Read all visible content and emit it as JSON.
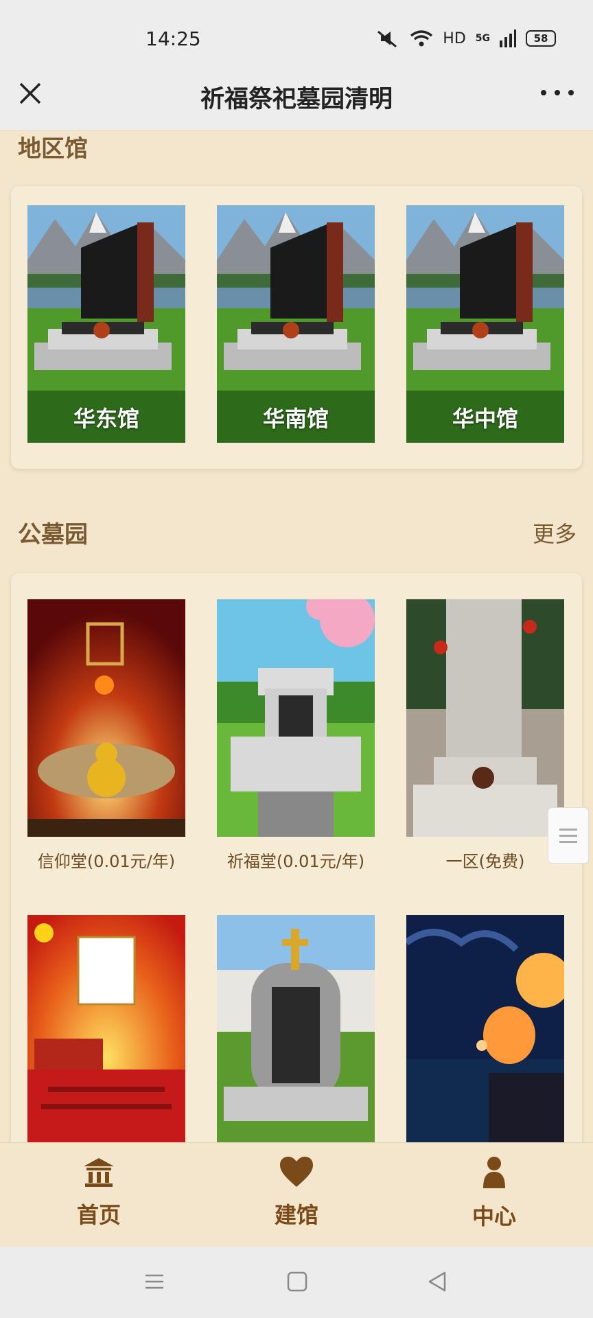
{
  "status": {
    "time": "14:25",
    "network": "HD",
    "signal": "5G",
    "battery": "58"
  },
  "header": {
    "title": "祈福祭祀墓园清明",
    "close_icon": "close-icon",
    "more_icon": "more-dots-icon"
  },
  "regions": {
    "title": "地区馆",
    "items": [
      {
        "label": "华东馆"
      },
      {
        "label": "华南馆"
      },
      {
        "label": "华中馆"
      }
    ]
  },
  "cemetery": {
    "title": "公墓园",
    "more": "更多",
    "items": [
      {
        "label": "信仰堂(0.01元/年)"
      },
      {
        "label": "祈福堂(0.01元/年)"
      },
      {
        "label": "一区(免费)"
      },
      {
        "label": ""
      },
      {
        "label": ""
      },
      {
        "label": ""
      }
    ]
  },
  "nav": {
    "items": [
      {
        "label": "首页",
        "icon": "temple-icon"
      },
      {
        "label": "建馆",
        "icon": "heart-icon"
      },
      {
        "label": "中心",
        "icon": "person-icon"
      }
    ]
  },
  "colors": {
    "background": "#f3e6cc",
    "accent": "#7a4a18",
    "title_bar": "#ededed"
  }
}
